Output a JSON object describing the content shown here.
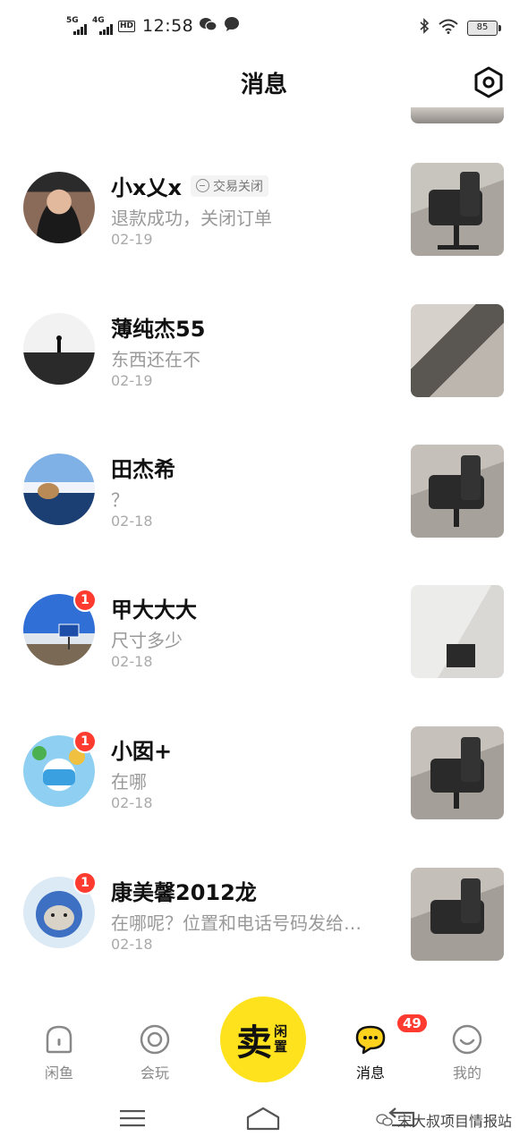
{
  "status_bar": {
    "net1": "5G",
    "net2": "4G",
    "hd": "HD",
    "time": "12:58",
    "battery": "85"
  },
  "header": {
    "title": "消息",
    "settings_icon": "hexagon-settings-icon"
  },
  "conversations": [
    {
      "name": "小x乂x",
      "status_tag": "交易关闭",
      "preview": "退款成功，关闭订单",
      "date": "02-19",
      "unread": ""
    },
    {
      "name": "薄纯杰55",
      "preview": "东西还在不",
      "date": "02-19",
      "unread": ""
    },
    {
      "name": "田杰希",
      "preview": "？",
      "date": "02-18",
      "unread": ""
    },
    {
      "name": "甲大大大",
      "preview": "尺寸多少",
      "date": "02-18",
      "unread": "1"
    },
    {
      "name": "小囡+",
      "preview": "在哪",
      "date": "02-18",
      "unread": "1"
    },
    {
      "name": "康美馨2012龙",
      "preview": "在哪呢？位置和电话号码发给…",
      "date": "02-18",
      "unread": "1"
    }
  ],
  "bottom_nav": {
    "home": "闲鱼",
    "play": "会玩",
    "sell_main": "卖",
    "sell_sub": "闲置",
    "messages": "消息",
    "messages_badge": "49",
    "mine": "我的"
  },
  "watermark": "宋大叔项目情报站",
  "colors": {
    "accent_yellow": "#ffe21e",
    "badge_red": "#ff3b30"
  }
}
